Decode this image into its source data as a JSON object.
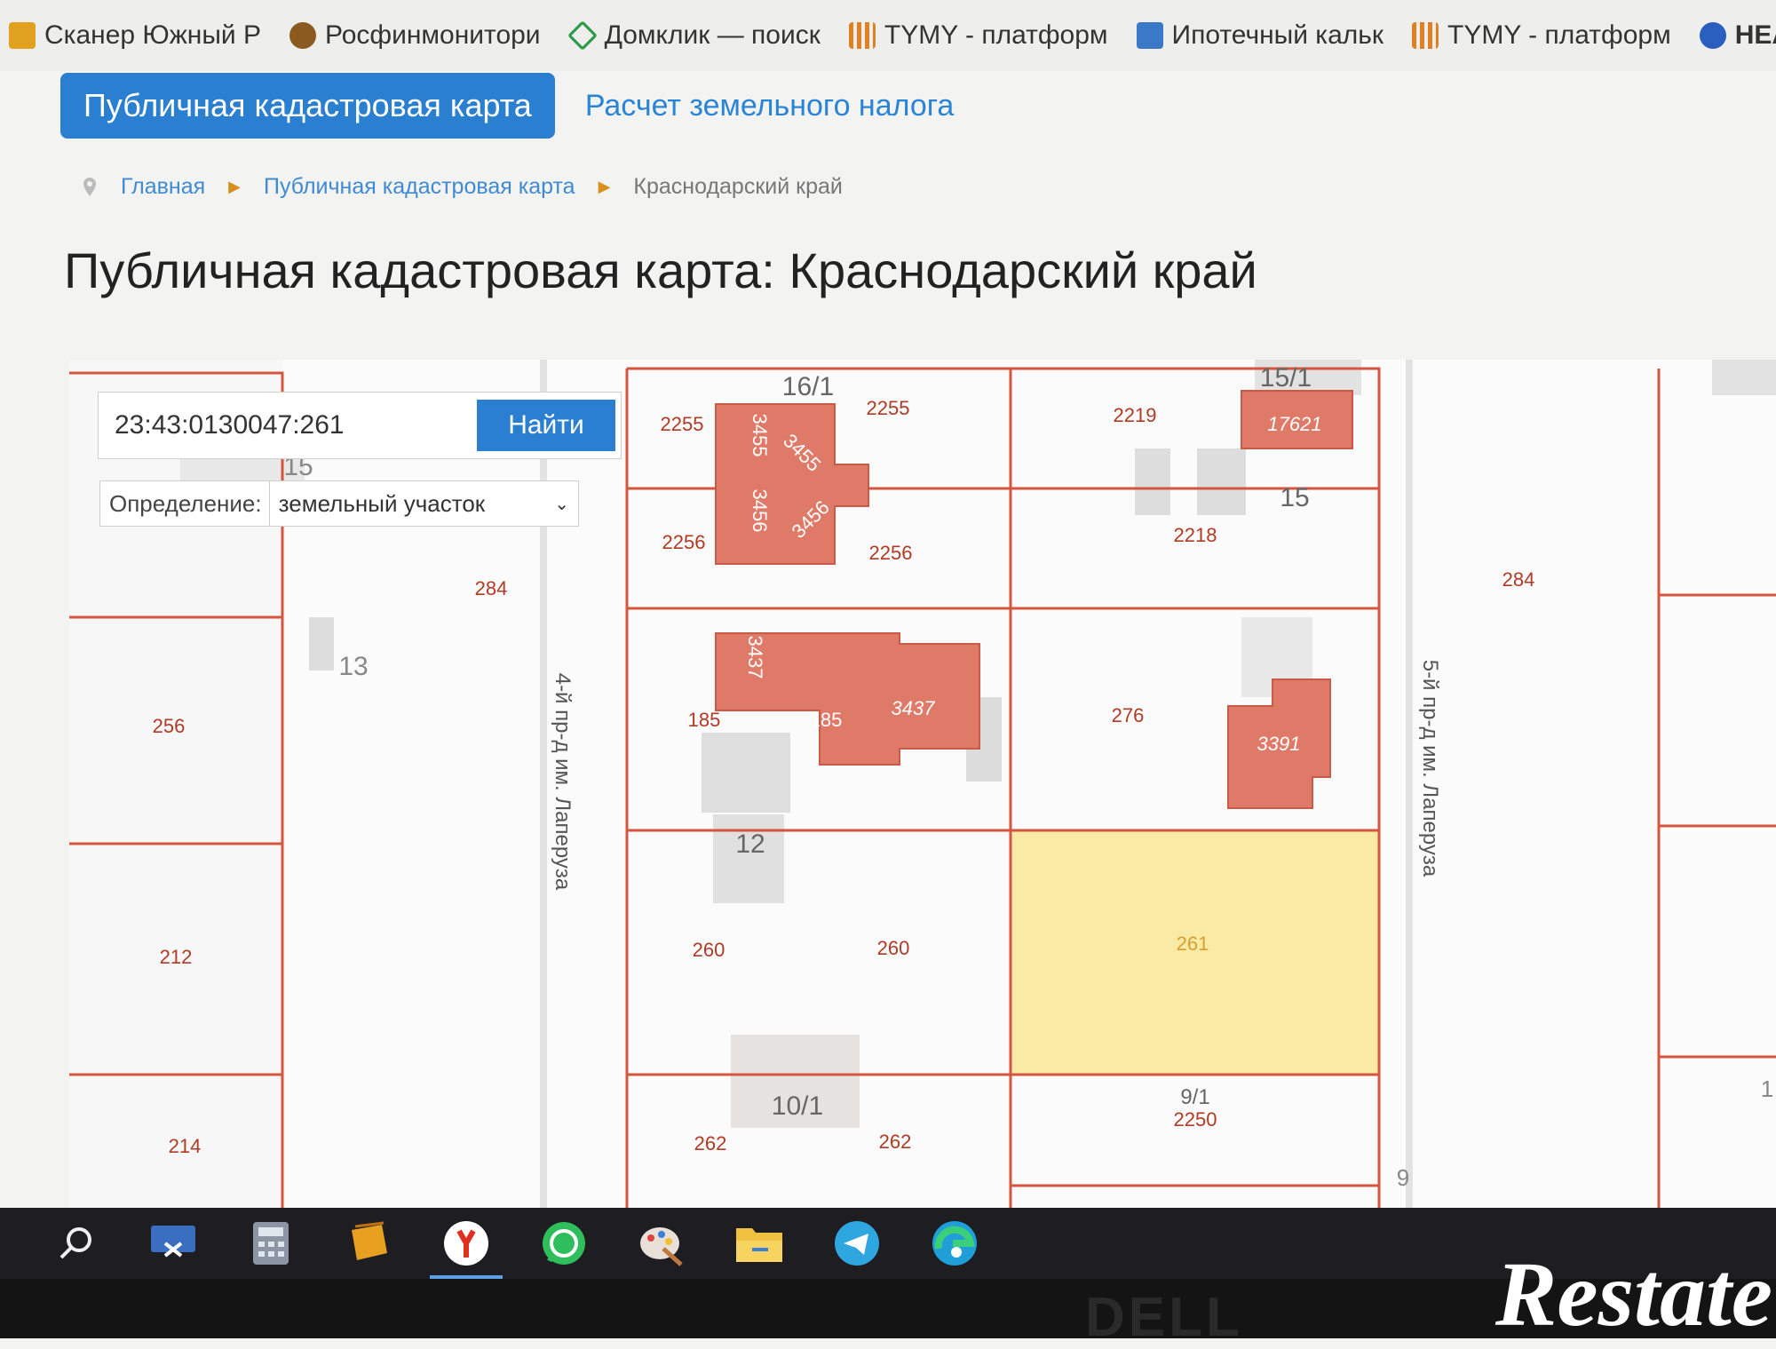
{
  "bookmarks": [
    {
      "label": "Сканер Южный Р",
      "color": "#e0a020"
    },
    {
      "label": "Росфинмонитори",
      "color": "#8a5a20"
    },
    {
      "label": "Домклик — поиск",
      "color": "#2f9a4a"
    },
    {
      "label": "TYMY - платформ",
      "color": "#e08020"
    },
    {
      "label": "Ипотечный кальк",
      "color": "#3a78c8"
    },
    {
      "label": "TYMY - платформ",
      "color": "#e08020"
    },
    {
      "label": "HEAL",
      "color": "#2a5fbf"
    }
  ],
  "nav": {
    "active_tab": "Публичная кадастровая карта",
    "link_tab": "Расчет земельного налога"
  },
  "breadcrumbs": {
    "home": "Главная",
    "map": "Публичная кадастровая карта",
    "current": "Краснодарский край"
  },
  "page_title": "Публичная кадастровая карта: Краснодарский край",
  "map": {
    "search_value": "23:43:0130047:261",
    "find_button": "Найти",
    "definition_label": "Определение:",
    "definition_value": "земельный участок",
    "labels": {
      "l15_1": "15/1",
      "l16_1": "16/1",
      "l2255a": "2255",
      "l2255b": "2255",
      "l2219": "2219",
      "l17621": "17621",
      "l15": "15",
      "l2256a": "2256",
      "l2256b": "2256",
      "l2218": "2218",
      "l3455a": "3455",
      "l3455b": "3455",
      "l3456a": "3456",
      "l3456b": "3456",
      "l284a": "284",
      "l284b": "284",
      "l13": "13",
      "l15left": "15",
      "l256": "256",
      "l3437a": "3437",
      "l3437b": "3437",
      "l185a": "185",
      "l185b": "185",
      "l276": "276",
      "l3391": "3391",
      "l12": "12",
      "l212": "212",
      "l260a": "260",
      "l260b": "260",
      "l261": "261",
      "l214": "214",
      "l10_1": "10/1",
      "l262a": "262",
      "l262b": "262",
      "l9_1": "9/1",
      "l2250": "2250",
      "l9": "9",
      "l1right": "1",
      "street_4": "4-й пр-д им. Лаперуза",
      "street_5": "5-й пр-д им. Лаперуза"
    },
    "colors": {
      "building": "#e07a68",
      "boundary": "#d6553e",
      "selected": "#f9eaa6"
    }
  },
  "taskbar": [
    {
      "name": "search-icon"
    },
    {
      "name": "snipping-tool-icon"
    },
    {
      "name": "calculator-icon"
    },
    {
      "name": "sticky-notes-icon"
    },
    {
      "name": "yandex-browser-icon"
    },
    {
      "name": "whatsapp-icon"
    },
    {
      "name": "paint-icon"
    },
    {
      "name": "file-explorer-icon"
    },
    {
      "name": "telegram-icon"
    },
    {
      "name": "edge-icon"
    }
  ],
  "laptop_brand": "DELL",
  "watermark": "Restate"
}
